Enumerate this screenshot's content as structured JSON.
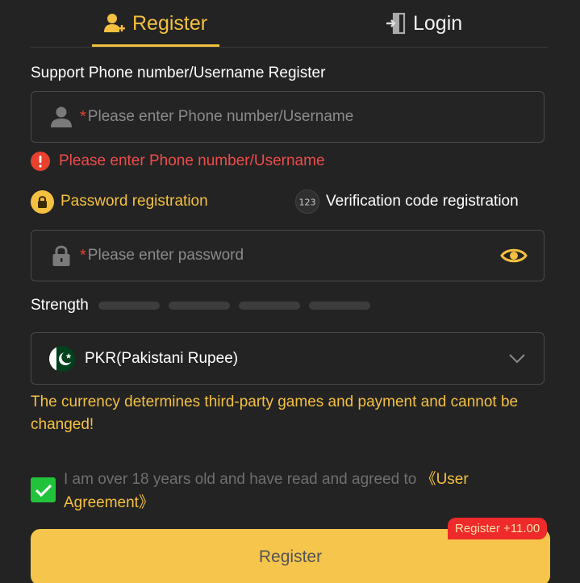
{
  "tabs": {
    "register": "Register",
    "login": "Login"
  },
  "form": {
    "section_title": "Support Phone number/Username Register",
    "username": {
      "required_mark": "*",
      "placeholder": "Please enter Phone number/Username"
    },
    "username_error": "Please enter Phone number/Username",
    "modes": {
      "password": "Password registration",
      "code": "Verification code registration",
      "code_icon_text": "123"
    },
    "password": {
      "required_mark": "*",
      "placeholder": "Please enter password"
    },
    "strength_label": "Strength",
    "currency": {
      "value": "PKR(Pakistani Rupee)",
      "note": "The currency determines third-party games and payment and cannot be changed!"
    },
    "agreement": {
      "checked": true,
      "text": "I am over 18 years old and have read and agreed to ",
      "link": "《User Agreement》"
    },
    "register_button": "Register",
    "bonus_badge": "Register +11.00"
  },
  "colors": {
    "accent": "#f4c040",
    "error": "#ef4b4b",
    "check": "#21c33b",
    "badge": "#ee2a2a"
  }
}
